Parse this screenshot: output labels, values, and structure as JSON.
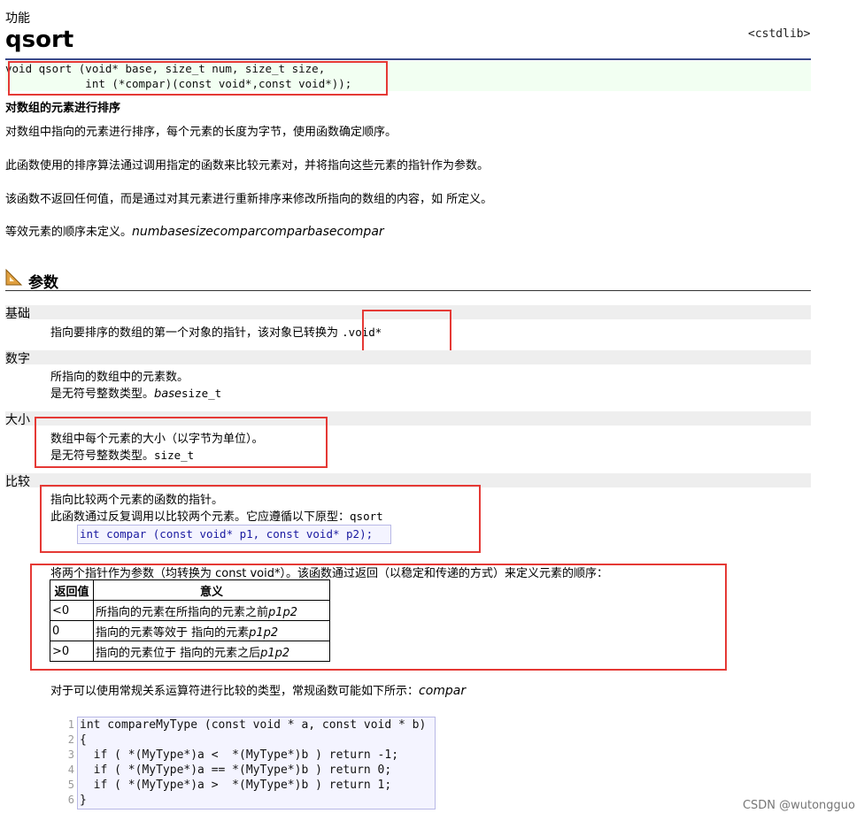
{
  "header": {
    "top_label": "功能",
    "title": "qsort",
    "library": "<cstdlib>"
  },
  "prototype": {
    "line1": "void qsort (void* base, size_t num, size_t size,",
    "line2": "            int (*compar)(const void*,const void*));"
  },
  "description": {
    "title": "对数组的元素进行排序",
    "p1": "对数组中指向的元素进行排序，每个元素的长度为字节，使用函数确定顺序。",
    "p2": "此函数使用的排序算法通过调用指定的函数来比较元素对，并将指向这些元素的指针作为参数。",
    "p3": "该函数不返回任何值，而是通过对其元素进行重新排序来修改所指向的数组的内容，如 所定义。",
    "p4_text": "等效元素的顺序未定义。",
    "p4_italic": "numbasesizecomparcomparbasecompar"
  },
  "params": {
    "heading": "参数",
    "base": {
      "term": "基础",
      "line1": "指向要排序的数组的第一个对象的指针，该对象已转换为 ",
      "line1_code": ".void*"
    },
    "num": {
      "term": "数字",
      "line1": "所指向的数组中的元素数。",
      "line2": "是无符号整数类型。",
      "line2_italic": "base",
      "line2_code": "size_t"
    },
    "size": {
      "term": "大小",
      "line1": "数组中每个元素的大小（以字节为单位）。",
      "line2": "是无符号整数类型。",
      "line2_code": "size_t"
    },
    "compar": {
      "term": "比较",
      "line1": "指向比较两个元素的函数的指针。",
      "line2": "此函数通过反复调用以比较两个元素。它应遵循以下原型：",
      "line2_code": "qsort",
      "proto": "int compar (const void* p1, const void* p2);",
      "line3": "将两个指针作为参数（均转换为 const void*）。该函数通过返回（以稳定和传递的方式）来定义元素的顺序：",
      "table": {
        "headers": [
          "返回值",
          "意义"
        ],
        "rows": [
          {
            "value": "<0",
            "meaning": "所指向的元素在所指向的元素之前",
            "italic": "p1p2"
          },
          {
            "value": "0",
            "meaning": "指向的元素等效于 指向的元素",
            "italic": "p1p2"
          },
          {
            "value": ">0",
            "meaning": "指向的元素位于 指向的元素之后",
            "italic": "p1p2"
          }
        ]
      },
      "line4": "对于可以使用常规关系运算符进行比较的类型，常规函数可能如下所示：",
      "line4_italic": "compar"
    }
  },
  "code_example": {
    "lines": [
      {
        "n": "1",
        "text": "int compareMyType (const void * a, const void * b)"
      },
      {
        "n": "2",
        "text": "{"
      },
      {
        "n": "3",
        "text": "  if ( *(MyType*)a <  *(MyType*)b ) return -1;"
      },
      {
        "n": "4",
        "text": "  if ( *(MyType*)a == *(MyType*)b ) return 0;"
      },
      {
        "n": "5",
        "text": "  if ( *(MyType*)a >  *(MyType*)b ) return 1;"
      },
      {
        "n": "6",
        "text": "}"
      }
    ]
  },
  "watermark": "CSDN @wutongguo",
  "colors": {
    "highlight_box": "#e53935",
    "rule": "#3a4a8a",
    "keyword": "#1a1aa0"
  }
}
